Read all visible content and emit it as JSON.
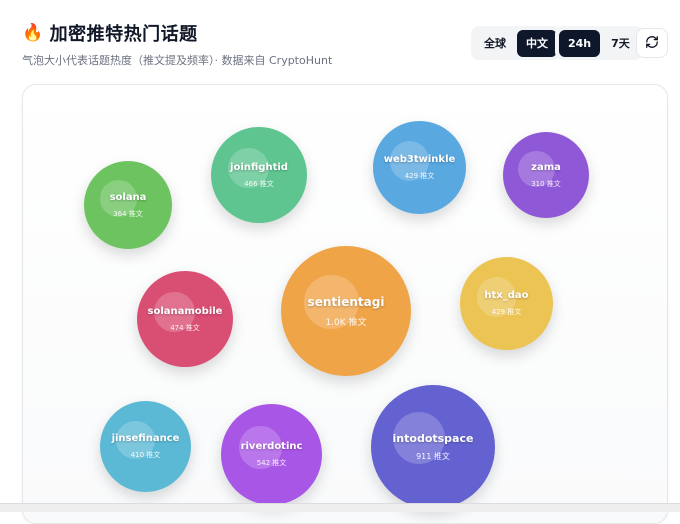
{
  "header": {
    "icon": "fire-icon",
    "title": "加密推特热门话题",
    "subtitle": "气泡大小代表话题热度（推文提及频率）· 数据来自 CryptoHunt"
  },
  "region_toggle": {
    "options": [
      "全球",
      "中文"
    ],
    "selected": "中文"
  },
  "time_toggle": {
    "options": [
      "24h",
      "7天"
    ],
    "selected": "24h"
  },
  "refresh_icon": "refresh-icon",
  "bubbles": [
    {
      "name": "solana",
      "count": "364 推文",
      "color": "#6cc35f"
    },
    {
      "name": "joinfightid",
      "count": "466 推文",
      "color": "#5ec590"
    },
    {
      "name": "web3twinkle",
      "count": "429 推文",
      "color": "#5aa8e0"
    },
    {
      "name": "zama",
      "count": "310 推文",
      "color": "#8f58d6"
    },
    {
      "name": "solanamobile",
      "count": "474 推文",
      "color": "#d94e73"
    },
    {
      "name": "sentientagi",
      "count": "1.0K 推文",
      "color": "#f0a448"
    },
    {
      "name": "htx_dao",
      "count": "429 推文",
      "color": "#ecc454"
    },
    {
      "name": "jinsefinance",
      "count": "410 推文",
      "color": "#5cb9d5"
    },
    {
      "name": "riverdotinc",
      "count": "542 推文",
      "color": "#a856e6"
    },
    {
      "name": "intodotspace",
      "count": "911 推文",
      "color": "#6462d0"
    }
  ]
}
